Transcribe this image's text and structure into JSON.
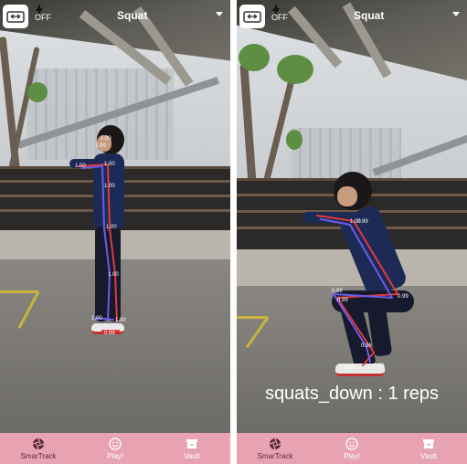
{
  "left_screen": {
    "flash_label": "OFF",
    "exercise_name": "Squat",
    "pose_scores": [
      "1.00",
      "1.00",
      "1.00",
      "1.00",
      "1.00",
      "1.00",
      "1.00",
      "1.00",
      "0.99",
      "1.00"
    ],
    "nav": [
      {
        "label": "SmarTrack",
        "icon": "aperture-icon",
        "active": true
      },
      {
        "label": "Play!",
        "icon": "smiley-icon",
        "active": false
      },
      {
        "label": "Vault",
        "icon": "vault-icon",
        "active": false
      }
    ]
  },
  "right_screen": {
    "flash_label": "OFF",
    "exercise_name": "Squat",
    "reps_text": "squats_down : 1 reps",
    "pose_scores": [
      "1.00",
      "0.99",
      "0.99",
      "0.99",
      "0.99",
      "0.96",
      "0.95",
      "0.93"
    ],
    "nav": [
      {
        "label": "SmarTrack",
        "icon": "aperture-icon",
        "active": true
      },
      {
        "label": "Play!",
        "icon": "smiley-icon",
        "active": false
      },
      {
        "label": "Vault",
        "icon": "vault-icon",
        "active": false
      }
    ]
  },
  "colors": {
    "nav_bg": "#e8a3b3",
    "skeleton_left": "#e03a3a",
    "skeleton_right": "#6a5ce8"
  }
}
